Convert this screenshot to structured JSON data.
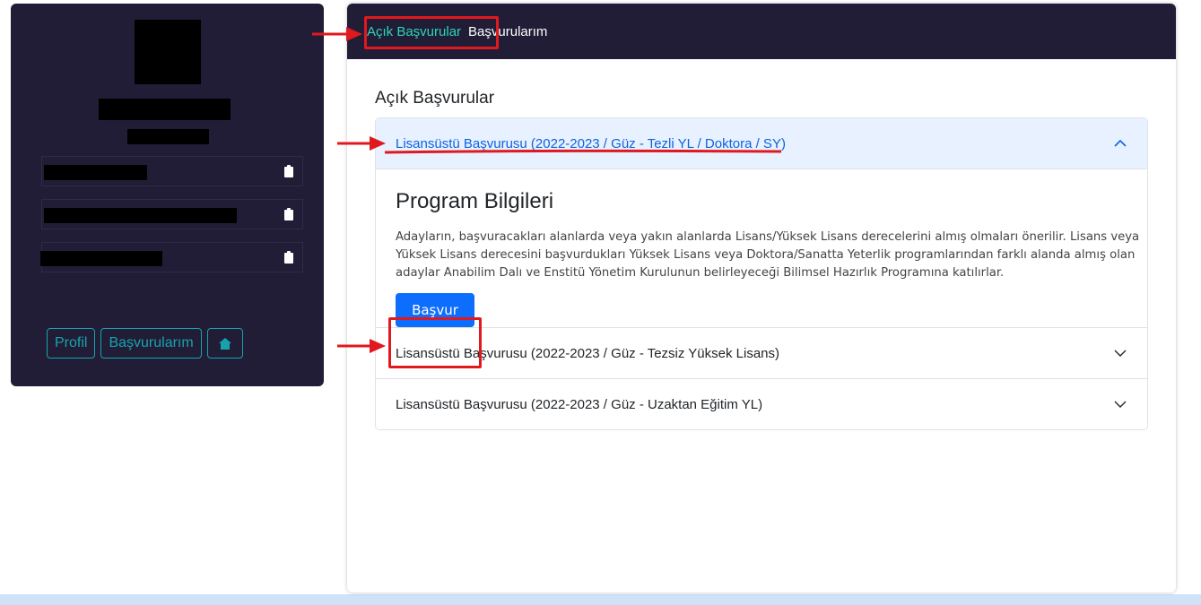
{
  "tabs": {
    "open_applications": "Açık Başvurular",
    "my_applications": "Başvurularım"
  },
  "profile": {
    "buttons": {
      "profile": "Profil",
      "applications": "Başvurularım"
    }
  },
  "main": {
    "section_title": "Açık Başvurular",
    "accordion": [
      {
        "title": "Lisansüstü Başvurusu (2022-2023 / Güz - Tezli YL / Doktora / SY)",
        "expanded": true,
        "program_title": "Program Bilgileri",
        "program_text": "Adayların, başvuracakları alanlarda veya yakın alanlarda Lisans/Yüksek Lisans derecelerini almış olmaları önerilir. Lisans veya Yüksek Lisans derecesini başvurdukları Yüksek Lisans veya Doktora/Sanatta Yeterlik programlarından farklı alanda almış olan adaylar Anabilim Dalı ve Enstitü Yönetim Kurulunun belirleyeceği Bilimsel Hazırlık Programına katılırlar.",
        "apply_label": "Başvur"
      },
      {
        "title": "Lisansüstü Başvurusu (2022-2023 / Güz - Tezsiz Yüksek Lisans)",
        "expanded": false
      },
      {
        "title": "Lisansüstü Başvurusu (2022-2023 / Güz - Uzaktan Eğitim YL)",
        "expanded": false
      }
    ]
  },
  "colors": {
    "nav_bg": "#221d36",
    "active_tab": "#2ad7b8",
    "accent_outline": "#16a3ae",
    "primary": "#0d6efd",
    "annotation_red": "#e0191f"
  }
}
